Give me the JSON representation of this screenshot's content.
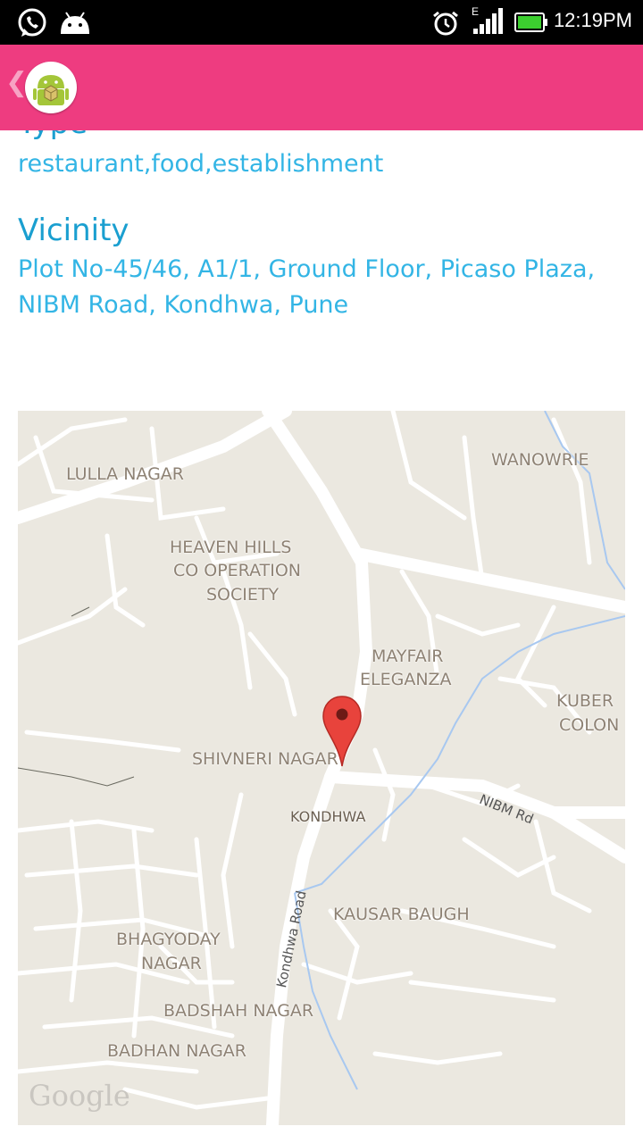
{
  "status_bar": {
    "time": "12:19PM",
    "network_type": "E",
    "icons": [
      "whatsapp-icon",
      "android-notification-icon",
      "alarm-icon",
      "signal-icon",
      "battery-icon"
    ]
  },
  "app_bar": {
    "back_icon": "chevron-left-icon",
    "logo_icon": "android-app-icon",
    "background": "#ee3c80"
  },
  "details": {
    "type_label": "Type",
    "type_value": "restaurant,food,establishment",
    "vicinity_label": "Vicinity",
    "vicinity_value": "Plot No-45/46, A1/1, Ground Floor, Picaso Plaza, NIBM Road, Kondhwa, Pune",
    "label_color": "#1a9fd0",
    "value_color": "#33b5e5"
  },
  "map": {
    "areas": {
      "lulla_nagar": "LULLA NAGAR",
      "wanowrie": "WANOWRIE",
      "heaven_hills": "HEAVEN HILLS",
      "heaven_hills_2": "CO OPERATION",
      "heaven_hills_3": "SOCIETY",
      "mayfair": "MAYFAIR",
      "mayfair_2": "ELEGANZA",
      "kuber": "KUBER",
      "kuber_2": "COLON",
      "shivneri": "SHIVNERI NAGAR",
      "kondhwa": "KONDHWA",
      "kausar_baugh": "KAUSAR BAUGH",
      "bhagyoday": "BHAGYODAY",
      "bhagyoday_2": "NAGAR",
      "badshah": "BADSHAH NAGAR",
      "badhan": "BADHAN NAGAR"
    },
    "roads": {
      "nibm": "NIBM Rd",
      "kondhwa_road": "Kondhwa Road"
    },
    "attribution": "Google",
    "marker_icon": "map-pin-icon",
    "marker_color": "#e8433c"
  }
}
